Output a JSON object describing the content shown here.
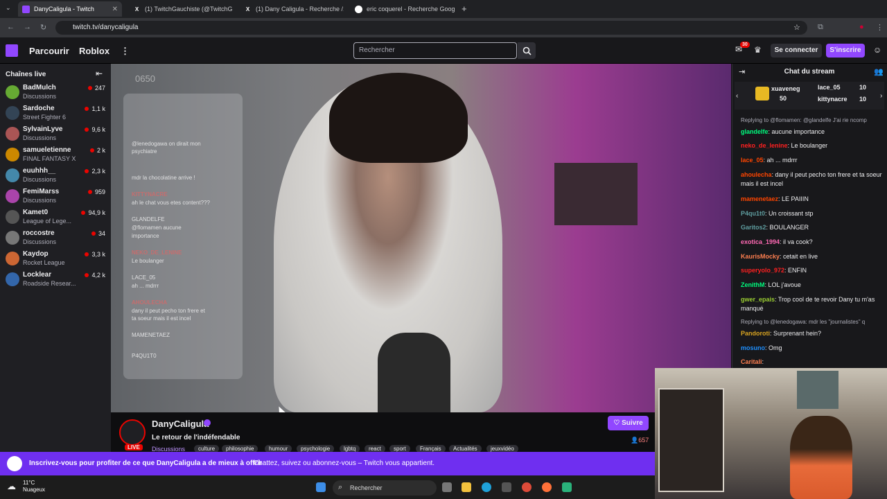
{
  "browser": {
    "tabs": [
      {
        "title": "DanyCaligula - Twitch"
      },
      {
        "title": "(1) TwitchGauchiste (@TwitchG..."
      },
      {
        "title": "(1) Dany Caligula - Recherche /..."
      },
      {
        "title": "eric coquerel - Recherche Goog..."
      }
    ],
    "url": "twitch.tv/danycaligula"
  },
  "topnav": {
    "browse": "Parcourir",
    "roblox": "Roblox",
    "more": "⋮",
    "search_placeholder": "Rechercher",
    "notif_count": "30",
    "login": "Se connecter",
    "signup": "S'inscrire"
  },
  "sidebar": {
    "title": "Chaînes live",
    "channels": [
      {
        "name": "BadMulch",
        "game": "Discussions",
        "viewers": "247"
      },
      {
        "name": "Sardoche",
        "game": "Street Fighter 6",
        "viewers": "1,1 k"
      },
      {
        "name": "SylvainLyve",
        "game": "Discussions",
        "viewers": "9,6 k"
      },
      {
        "name": "samueletienne",
        "game": "FINAL FANTASY X",
        "viewers": "2 k"
      },
      {
        "name": "euuhhh__",
        "game": "Discussions",
        "viewers": "2,3 k"
      },
      {
        "name": "FemiMarss",
        "game": "Discussions",
        "viewers": "959"
      },
      {
        "name": "Kamet0",
        "game": "League of Lege...",
        "viewers": "94,9 k"
      },
      {
        "name": "roccostre",
        "game": "Discussions",
        "viewers": "34"
      },
      {
        "name": "Kaydop",
        "game": "Rocket League",
        "viewers": "3,3 k"
      },
      {
        "name": "Locklear",
        "game": "Roadside Resear...",
        "viewers": "4,2 k"
      }
    ]
  },
  "video": {
    "corner_num": "0650",
    "overlay_lines": [
      {
        "t": "@lenedogawa on dirait mon",
        "h": false
      },
      {
        "t": "psychiatre",
        "h": false
      },
      {
        "t": "mdr la chocolatine arrive !",
        "h": false
      },
      {
        "t": "KITTYNACRE",
        "h": true
      },
      {
        "t": "ah le chat vous etes content???",
        "h": false
      },
      {
        "t": "GLANDELFE",
        "h": false
      },
      {
        "t": "@flomamen aucune",
        "h": false
      },
      {
        "t": "importance",
        "h": false
      },
      {
        "t": "NEKO_DE_LENINE",
        "h": true
      },
      {
        "t": "Le boulanger",
        "h": false
      },
      {
        "t": "LACE_05",
        "h": false
      },
      {
        "t": "ah ... mdrrr",
        "h": false
      },
      {
        "t": "AHOULECHA",
        "h": true
      },
      {
        "t": "dany il peut pecho ton frere et",
        "h": false
      },
      {
        "t": "ta soeur mais il est incel",
        "h": false
      },
      {
        "t": "MAMENETAEZ",
        "h": false
      },
      {
        "t": "P4QU1T0",
        "h": false
      }
    ]
  },
  "stream": {
    "channel": "DanyCaligula",
    "live": "LIVE",
    "title": "Le retour de l'indéfendable",
    "category": "Discussions",
    "tags": [
      "culture",
      "philosophie",
      "humour",
      "psychologie",
      "lgbtq",
      "react",
      "sport",
      "Français",
      "Actualités",
      "jeuxvidéo"
    ],
    "follow": "Suivre",
    "viewers": "657"
  },
  "chat": {
    "title": "Chat du stream",
    "gifts": [
      {
        "user": "xuaveneg",
        "count": "50"
      },
      {
        "user": "lace_05",
        "count": "10"
      },
      {
        "user": "kittynacre",
        "count": "10"
      }
    ],
    "messages": [
      {
        "reply": "Replying to @flomamen: @glandelfe J'ai rie ncomp"
      },
      {
        "user": "glandelfe",
        "color": "#00ff7f",
        "text": ": aucune importance"
      },
      {
        "user": "neko_de_lenine",
        "color": "#ff2020",
        "text": ": Le boulanger"
      },
      {
        "user": "lace_05",
        "color": "#ff4500",
        "text": ": ah ... mdrrr"
      },
      {
        "user": "ahoulecha",
        "color": "#ff4500",
        "text": ": dany il peut pecho ton frere et ta soeur mais il est incel"
      },
      {
        "user": "mamenetaez",
        "color": "#ff4500",
        "text": ": LE PAIIIN"
      },
      {
        "user": "P4qu1t0",
        "color": "#5f9ea0",
        "text": ": Un croissant stp"
      },
      {
        "user": "Garitos2",
        "color": "#5f9ea0",
        "text": ": BOULANGER"
      },
      {
        "user": "exotica_1994",
        "color": "#ff69b4",
        "text": ": il va cook?"
      },
      {
        "user": "KaurisMocky",
        "color": "#ff7f50",
        "text": ": cetait en live"
      },
      {
        "user": "superyolo_972",
        "color": "#ff2020",
        "text": ": ENFIN"
      },
      {
        "user": "ZenithM",
        "color": "#00ff7f",
        "text": ": LOL j'avoue"
      },
      {
        "user": "gwer_epais",
        "color": "#9acd32",
        "text": ": Trop cool de te revoir Dany tu m'as manqué"
      },
      {
        "reply": "Replying to @lenedogawa: mdr les \"journalistes\" q"
      },
      {
        "user": "Pandoroti",
        "color": "#daa520",
        "text": ": Surprenant hein?"
      },
      {
        "user": "mosuno",
        "color": "#1e90ff",
        "text": ": Omg"
      },
      {
        "user": "Caritali",
        "color": "#ff7f50",
        "text": ": "
      }
    ]
  },
  "banner": {
    "text": "Inscrivez-vous pour profiter de ce que DanyCaligula a de mieux à offrir",
    "text2": "Chattez, suivez ou abonnez-vous – Twitch vous appartient."
  },
  "taskbar": {
    "temp": "11°C",
    "weather": "Nuageux",
    "search": "Rechercher"
  },
  "colors": {
    "twitch_purple": "#9147ff",
    "live_red": "#eb0400",
    "banner": "#6f2ff0"
  }
}
